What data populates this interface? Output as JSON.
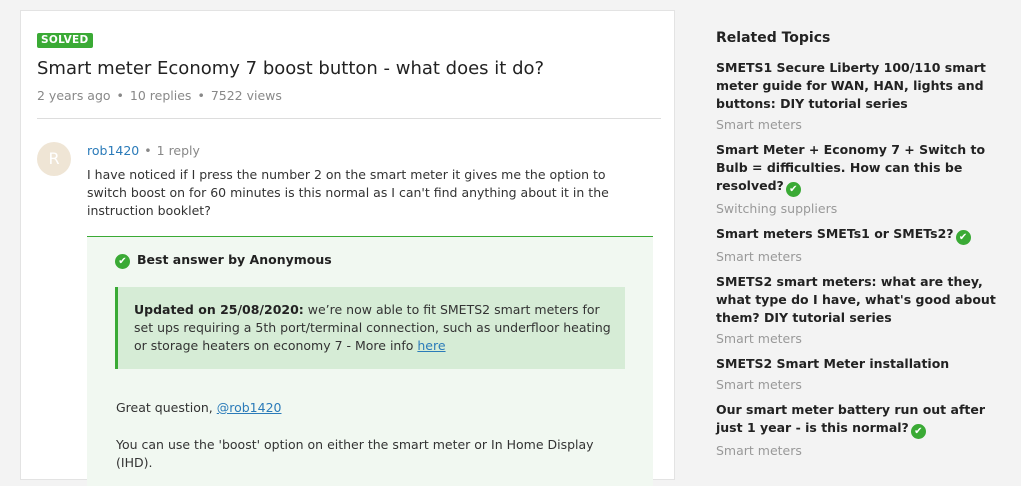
{
  "post": {
    "badge": "SOLVED",
    "title": "Smart meter Economy 7 boost button - what does it do?",
    "meta": {
      "age": "2 years ago",
      "replies": "10 replies",
      "views": "7522 views"
    },
    "author": {
      "avatar_letter": "R",
      "name": "rob1420",
      "reply_count": "1 reply"
    },
    "body": "I have noticed if I press the number 2 on the smart meter it gives me the option to switch boost on for 60 minutes is this normal as I can't find anything about it in the instruction booklet?"
  },
  "best_answer": {
    "heading": "Best answer by Anonymous",
    "quote": {
      "bold": "Updated on 25/08/2020:",
      "text": " we’re now able to fit SMETS2 smart meters for set ups requiring a 5th port/terminal connection, such as underfloor heating or storage heaters on economy 7 - More info ",
      "link": "here"
    },
    "p1_prefix": "Great question, ",
    "p1_mention": "@rob1420",
    "p2": "You can use the 'boost' option on either the smart meter or In Home Display (IHD)."
  },
  "related": {
    "title": "Related Topics",
    "topics": [
      {
        "title": "SMETS1 Secure Liberty 100/110 smart meter guide for WAN, HAN, lights and buttons: DIY tutorial series",
        "category": "Smart meters",
        "solved": false
      },
      {
        "title": "Smart Meter + Economy 7 + Switch to Bulb = difficulties. How can this be resolved?",
        "category": "Switching suppliers",
        "solved": true
      },
      {
        "title": "Smart meters SMETs1 or SMETs2?",
        "category": "Smart meters",
        "solved": true
      },
      {
        "title": "SMETS2 smart meters: what are they, what type do I have, what's good about them? DIY tutorial series",
        "category": "Smart meters",
        "solved": false
      },
      {
        "title": "SMETS2 Smart Meter installation",
        "category": "Smart meters",
        "solved": false
      },
      {
        "title": "Our smart meter battery run out after just 1 year - is this normal?",
        "category": "Smart meters",
        "solved": true
      }
    ]
  },
  "icons": {
    "check": "check-circle-icon"
  },
  "colors": {
    "solved_green": "#3aaa35",
    "link_blue": "#2b7bb9",
    "quote_bg": "#d6ecd6",
    "answer_bg": "#f1f8f1"
  }
}
